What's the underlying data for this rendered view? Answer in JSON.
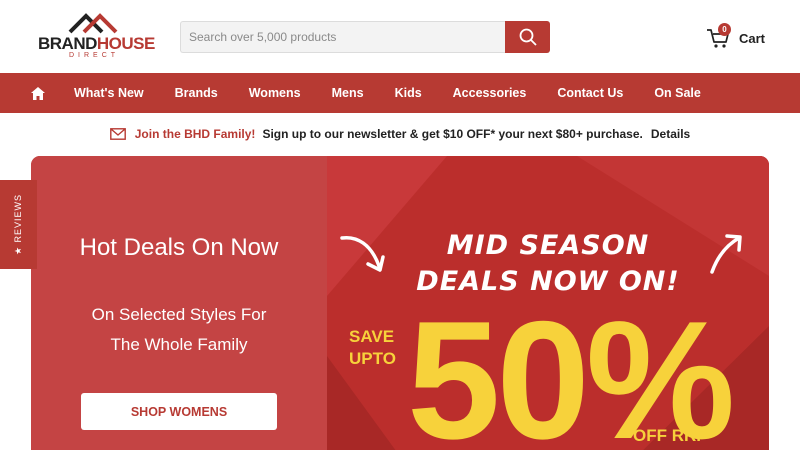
{
  "brand": {
    "name_part1": "BRAND",
    "name_part2": "HOUSE",
    "tagline": "DIRECT",
    "accent": "#b73a33"
  },
  "search": {
    "placeholder": "Search over 5,000 products",
    "value": "",
    "icon": "search-icon"
  },
  "cart": {
    "label": "Cart",
    "count": "0",
    "icon": "cart-icon"
  },
  "nav": {
    "home_icon": "home-icon",
    "items": [
      {
        "label": "What's New"
      },
      {
        "label": "Brands"
      },
      {
        "label": "Womens"
      },
      {
        "label": "Mens"
      },
      {
        "label": "Kids"
      },
      {
        "label": "Accessories"
      },
      {
        "label": "Contact Us"
      },
      {
        "label": "On Sale"
      }
    ]
  },
  "promo": {
    "icon": "mail-icon",
    "join": "Join the BHD Family!",
    "text": "Sign up to our newsletter & get $10 OFF* your next $80+ purchase.",
    "details": "Details"
  },
  "hero": {
    "title": "Hot Deals On Now",
    "subtitle_line1": "On Selected Styles For",
    "subtitle_line2": "The Whole Family",
    "button": "SHOP WOMENS",
    "banner_line1": "MID SEASON",
    "banner_line2": "DEALS NOW ON!",
    "save_line1": "SAVE",
    "save_line2": "UPTO",
    "big_number": "50%",
    "off": "OFF RRP",
    "highlight_color": "#f7d23b"
  },
  "reviews_tab": {
    "label": "★ REVIEWS"
  }
}
